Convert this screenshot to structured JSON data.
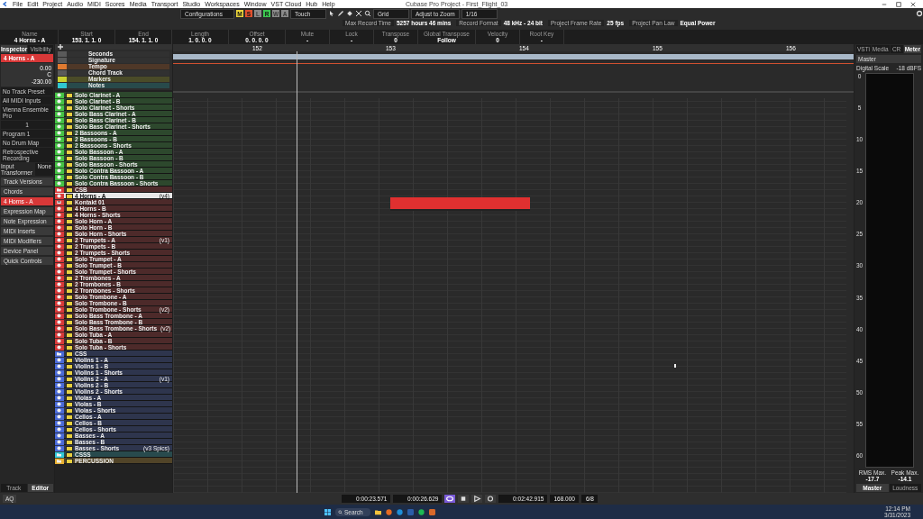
{
  "window": {
    "title": "Cubase Pro Project - First_Flight_03"
  },
  "menu": [
    "File",
    "Edit",
    "Project",
    "Audio",
    "MIDI",
    "Scores",
    "Media",
    "Transport",
    "Studio",
    "Workspaces",
    "Window",
    "VST Cloud",
    "Hub",
    "Help"
  ],
  "toolbar": {
    "configurations": "Configurations",
    "automation_mode": "Touch",
    "snap_type": "Grid",
    "grid_type": "Adjust to Zoom",
    "quantize": "1/16",
    "mode_buttons": [
      {
        "label": "M",
        "on": true,
        "color": "#e8d23a"
      },
      {
        "label": "S",
        "on": true,
        "color": "#e0502e"
      },
      {
        "label": "L",
        "on": false,
        "color": "#8a8a8a"
      },
      {
        "label": "R",
        "on": true,
        "color": "#3cc850"
      },
      {
        "label": "W",
        "on": false,
        "color": "#8a8a8a"
      },
      {
        "label": "A",
        "on": false,
        "color": "#8a8a8a"
      }
    ]
  },
  "project_info": [
    {
      "label": "Max Record Time",
      "value": "5257 hours 46 mins"
    },
    {
      "label": "Record Format",
      "value": "48 kHz - 24 bit"
    },
    {
      "label": "Project Frame Rate",
      "value": "25 fps"
    },
    {
      "label": "Project Pan Law",
      "value": "Equal Power"
    }
  ],
  "info_line": [
    {
      "label": "Name",
      "value": "4 Horns - A"
    },
    {
      "label": "Start",
      "value": "153. 1. 1. 0"
    },
    {
      "label": "End",
      "value": "154. 1. 1. 0"
    },
    {
      "label": "Length",
      "value": "1. 0. 0. 0"
    },
    {
      "label": "Offset",
      "value": "0. 0. 0. 0"
    },
    {
      "label": "Mute",
      "value": "-"
    },
    {
      "label": "Lock",
      "value": "-"
    },
    {
      "label": "Transpose",
      "value": "0"
    },
    {
      "label": "Global Transpose",
      "value": "Follow"
    },
    {
      "label": "Velocity",
      "value": "0"
    },
    {
      "label": "Root Key",
      "value": "-"
    }
  ],
  "inspector": {
    "tabs": [
      {
        "label": "Inspector",
        "selected": true
      },
      {
        "label": "Visibility",
        "selected": false
      }
    ],
    "track_name": "4 Horns - A",
    "volume": "0.00",
    "pan": "C",
    "delay": "-230.00",
    "fields": [
      "No Track Preset",
      "All MIDI Inputs",
      "Vienna Ensemble Pro"
    ],
    "channel": "1",
    "program_fields": [
      "Program 1",
      "No Drum Map",
      "Retrospective Recording"
    ],
    "input_transformer": {
      "label": "Input Transformer",
      "value": "None"
    },
    "sections": [
      {
        "label": "Track Versions",
        "highlight": false
      },
      {
        "label": "Chords",
        "highlight": false
      },
      {
        "label": "4 Horns - A",
        "highlight": true
      },
      {
        "label": "Expression Map",
        "highlight": false
      },
      {
        "label": "Note Expression",
        "highlight": false
      },
      {
        "label": "MIDI Inserts",
        "highlight": false
      },
      {
        "label": "MIDI Modifiers",
        "highlight": false
      },
      {
        "label": "Device Panel",
        "highlight": false
      },
      {
        "label": "Quick Controls",
        "highlight": false
      }
    ],
    "bottom_tabs": [
      {
        "label": "Track",
        "selected": false
      },
      {
        "label": "Editor",
        "selected": true
      }
    ]
  },
  "ruler": [
    "152",
    "153",
    "154",
    "155",
    "156"
  ],
  "global_tracks": [
    {
      "name": "Seconds",
      "color": "#5a5a5a"
    },
    {
      "name": "Signature",
      "color": "#5a5a5a"
    },
    {
      "name": "Tempo",
      "color": "#e07a30"
    },
    {
      "name": "Chord Track",
      "color": "#5a5a5a"
    },
    {
      "name": "Markers",
      "color": "#c8d030"
    },
    {
      "name": "Notes",
      "color": "#30c8d0"
    }
  ],
  "tracks": [
    {
      "name": "Solo Clarinet - A",
      "kind": "midi",
      "selected": false,
      "color": "#44c244"
    },
    {
      "name": "Solo Clarinet - B",
      "kind": "midi",
      "selected": false,
      "color": "#44c244"
    },
    {
      "name": "Solo Clarinet - Shorts",
      "kind": "midi",
      "selected": false,
      "color": "#44c244"
    },
    {
      "name": "Solo Bass Clarinet - A",
      "kind": "midi",
      "selected": false,
      "color": "#44c244"
    },
    {
      "name": "Solo Bass Clarinet - B",
      "kind": "midi",
      "selected": false,
      "color": "#44c244"
    },
    {
      "name": "Solo Bass Clarinet - Shorts",
      "kind": "midi",
      "selected": false,
      "color": "#44c244"
    },
    {
      "name": "2 Bassoons - A",
      "kind": "midi",
      "selected": false,
      "color": "#44c244"
    },
    {
      "name": "2 Bassoons - B",
      "kind": "midi",
      "selected": false,
      "color": "#44c244"
    },
    {
      "name": "2 Bassoons - Shorts",
      "kind": "midi",
      "selected": false,
      "color": "#44c244"
    },
    {
      "name": "Solo Bassoon - A",
      "kind": "midi",
      "selected": false,
      "color": "#44c244"
    },
    {
      "name": "Solo Bassoon - B",
      "kind": "midi",
      "selected": false,
      "color": "#44c244"
    },
    {
      "name": "Solo Bassoon - Shorts",
      "kind": "midi",
      "selected": false,
      "color": "#44c244"
    },
    {
      "name": "Solo Contra Bassoon - A",
      "kind": "midi",
      "selected": false,
      "color": "#44c244"
    },
    {
      "name": "Solo Contra Bassoon - B",
      "kind": "midi",
      "selected": false,
      "color": "#44c244"
    },
    {
      "name": "Solo Contra Bassoon - Shorts",
      "kind": "midi",
      "selected": false,
      "color": "#44c244"
    },
    {
      "name": "CSB",
      "kind": "folder",
      "selected": false,
      "color": "#d83838",
      "children": [
        {
          "name": "4 Horns - A",
          "kind": "midi",
          "selected": true,
          "version": "(v4)",
          "color": "#d83838"
        },
        {
          "name": "Kontakt 01",
          "kind": "instrument",
          "selected": false,
          "color": "#d83838"
        },
        {
          "name": "4 Horns - B",
          "kind": "midi",
          "selected": false,
          "color": "#d83838"
        },
        {
          "name": "4 Horns - Shorts",
          "kind": "midi",
          "selected": false,
          "color": "#d83838"
        },
        {
          "name": "Solo Horn - A",
          "kind": "midi",
          "selected": false,
          "color": "#d83838"
        },
        {
          "name": "Solo Horn - B",
          "kind": "midi",
          "selected": false,
          "color": "#d83838"
        },
        {
          "name": "Solo Horn - Shorts",
          "kind": "midi",
          "selected": false,
          "color": "#d83838"
        },
        {
          "name": "2 Trumpets - A",
          "kind": "midi",
          "selected": false,
          "version": "(v1)",
          "color": "#d83838"
        },
        {
          "name": "2 Trumpets - B",
          "kind": "midi",
          "selected": false,
          "color": "#d83838"
        },
        {
          "name": "2 Trumpets - Shorts",
          "kind": "midi",
          "selected": false,
          "color": "#d83838"
        },
        {
          "name": "Solo Trumpet - A",
          "kind": "midi",
          "selected": false,
          "color": "#d83838"
        },
        {
          "name": "Solo Trumpet - B",
          "kind": "midi",
          "selected": false,
          "color": "#d83838"
        },
        {
          "name": "Solo Trumpet - Shorts",
          "kind": "midi",
          "selected": false,
          "color": "#d83838"
        },
        {
          "name": "2 Trombones - A",
          "kind": "midi",
          "selected": false,
          "color": "#d83838"
        },
        {
          "name": "2 Trombones - B",
          "kind": "midi",
          "selected": false,
          "color": "#d83838"
        },
        {
          "name": "2 Trombones - Shorts",
          "kind": "midi",
          "selected": false,
          "color": "#d83838"
        },
        {
          "name": "Solo Trombone - A",
          "kind": "midi",
          "selected": false,
          "color": "#d83838"
        },
        {
          "name": "Solo Trombone - B",
          "kind": "midi",
          "selected": false,
          "color": "#d83838"
        },
        {
          "name": "Solo Trombone - Shorts",
          "kind": "midi",
          "selected": false,
          "version": "(v2)",
          "color": "#d83838"
        },
        {
          "name": "Solo Bass Trombone - A",
          "kind": "midi",
          "selected": false,
          "color": "#d83838"
        },
        {
          "name": "Solo Bass Trombone - B",
          "kind": "midi",
          "selected": false,
          "color": "#d83838"
        },
        {
          "name": "Solo Bass Trombone - Shorts",
          "kind": "midi",
          "selected": false,
          "version": "(v2)",
          "color": "#d83838"
        },
        {
          "name": "Solo Tuba - A",
          "kind": "midi",
          "selected": false,
          "color": "#d83838"
        },
        {
          "name": "Solo Tuba - B",
          "kind": "midi",
          "selected": false,
          "color": "#d83838"
        },
        {
          "name": "Solo Tuba - Shorts",
          "kind": "midi",
          "selected": false,
          "color": "#d83838"
        }
      ]
    },
    {
      "name": "CSS",
      "kind": "folder",
      "selected": false,
      "color": "#4a6ad8",
      "children": [
        {
          "name": "Violins 1 - A",
          "kind": "midi",
          "selected": false,
          "color": "#4a6ad8"
        },
        {
          "name": "Violins 1 - B",
          "kind": "midi",
          "selected": false,
          "color": "#4a6ad8"
        },
        {
          "name": "Violins 1 - Shorts",
          "kind": "midi",
          "selected": false,
          "color": "#4a6ad8"
        },
        {
          "name": "Violins 2 - A",
          "kind": "midi",
          "selected": false,
          "version": "(v1)",
          "color": "#4a6ad8"
        },
        {
          "name": "Violins 2 - B",
          "kind": "midi",
          "selected": false,
          "color": "#4a6ad8"
        },
        {
          "name": "Violins 2 - Shorts",
          "kind": "midi",
          "selected": false,
          "color": "#4a6ad8"
        },
        {
          "name": "Violas - A",
          "kind": "midi",
          "selected": false,
          "color": "#4a6ad8"
        },
        {
          "name": "Violas - B",
          "kind": "midi",
          "selected": false,
          "color": "#4a6ad8"
        },
        {
          "name": "Violas - Shorts",
          "kind": "midi",
          "selected": false,
          "color": "#4a6ad8"
        },
        {
          "name": "Cellos - A",
          "kind": "midi",
          "selected": false,
          "color": "#4a6ad8"
        },
        {
          "name": "Cellos - B",
          "kind": "midi",
          "selected": false,
          "color": "#4a6ad8"
        },
        {
          "name": "Cellos - Shorts",
          "kind": "midi",
          "selected": false,
          "color": "#4a6ad8"
        },
        {
          "name": "Basses - A",
          "kind": "midi",
          "selected": false,
          "color": "#4a6ad8"
        },
        {
          "name": "Basses - B",
          "kind": "midi",
          "selected": false,
          "color": "#4a6ad8"
        },
        {
          "name": "Basses - Shorts",
          "kind": "midi",
          "selected": false,
          "version": "(v3 Spics)",
          "color": "#4a6ad8"
        }
      ]
    },
    {
      "name": "CSSS",
      "kind": "folder",
      "selected": false,
      "color": "#30c8d8"
    },
    {
      "name": "PERCUSSION",
      "kind": "folder",
      "selected": false,
      "color": "#e8b030"
    }
  ],
  "right_zone": {
    "tabs": [
      {
        "label": "VSTi",
        "selected": false
      },
      {
        "label": "Media",
        "selected": false
      },
      {
        "label": "CR",
        "selected": false
      },
      {
        "label": "Meter",
        "selected": true
      }
    ],
    "meter_title": "Master",
    "scale_name": "Digital Scale",
    "scale_ref": "-18 dBFS",
    "scale": [
      "0",
      "5",
      "10",
      "15",
      "20",
      "25",
      "30",
      "35",
      "40",
      "45",
      "50",
      "55",
      "60"
    ],
    "readings": [
      {
        "label": "RMS Max.",
        "value": "-17.7"
      },
      {
        "label": "Peak Max.",
        "value": "-14.1"
      }
    ],
    "bottom_tabs": [
      {
        "label": "Master",
        "selected": true
      },
      {
        "label": "Loudness",
        "selected": false
      }
    ]
  },
  "transport": {
    "aq": "AQ",
    "left_locator": "0:00:23.571",
    "right_locator": "0:00:26.629",
    "position": "0:02:42.915",
    "tempo": "168.000",
    "signature": "6/8"
  },
  "taskbar": {
    "search": "Search",
    "time": "12:14 PM",
    "date": "3/31/2023"
  }
}
